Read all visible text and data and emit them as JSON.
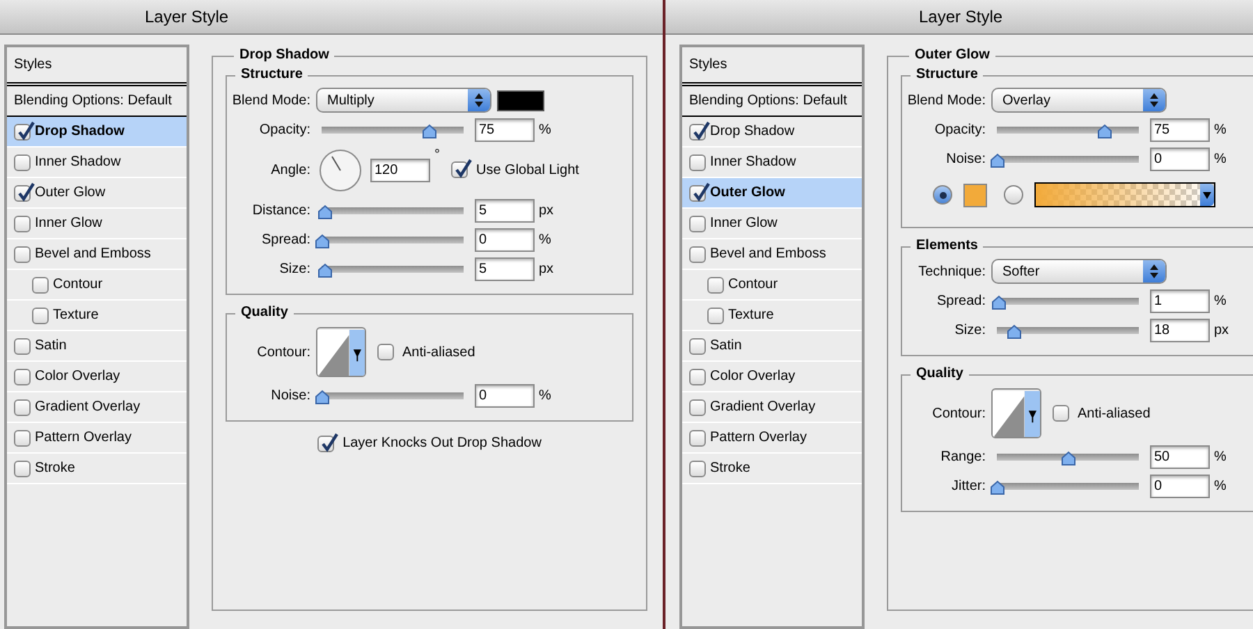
{
  "windows": [
    {
      "title": "Layer Style",
      "styles_header": "Styles",
      "styles": [
        {
          "label": "Blending Options: Default",
          "kind": "plain",
          "selected": false
        },
        {
          "label": "Drop Shadow",
          "kind": "check",
          "checked": true,
          "selected": true
        },
        {
          "label": "Inner Shadow",
          "kind": "check",
          "checked": false,
          "selected": false
        },
        {
          "label": "Outer Glow",
          "kind": "check",
          "checked": true,
          "selected": false
        },
        {
          "label": "Inner Glow",
          "kind": "check",
          "checked": false,
          "selected": false
        },
        {
          "label": "Bevel and Emboss",
          "kind": "check",
          "checked": false,
          "selected": false,
          "children": [
            {
              "label": "Contour",
              "kind": "check",
              "checked": false,
              "selected": false
            },
            {
              "label": "Texture",
              "kind": "check",
              "checked": false,
              "selected": false
            }
          ]
        },
        {
          "label": "Satin",
          "kind": "check",
          "checked": false,
          "selected": false
        },
        {
          "label": "Color Overlay",
          "kind": "check",
          "checked": false,
          "selected": false
        },
        {
          "label": "Gradient Overlay",
          "kind": "check",
          "checked": false,
          "selected": false
        },
        {
          "label": "Pattern Overlay",
          "kind": "check",
          "checked": false,
          "selected": false
        },
        {
          "label": "Stroke",
          "kind": "check",
          "checked": false,
          "selected": false
        }
      ],
      "panel": {
        "title": "Drop Shadow",
        "groups": [
          {
            "title": "Structure",
            "rows": [
              {
                "kind": "select",
                "label": "Blend Mode:",
                "value": "Multiply",
                "color": "#000000"
              },
              {
                "kind": "slider",
                "label": "Opacity:",
                "level": 0.75,
                "value": "75",
                "unit": "%"
              },
              {
                "kind": "angle",
                "label": "Angle:",
                "value": "120",
                "unit": "°",
                "checkbox": {
                  "label": "Use Global Light",
                  "checked": true
                }
              },
              {
                "kind": "slider",
                "label": "Distance:",
                "level": 0.02,
                "value": "5",
                "unit": "px"
              },
              {
                "kind": "slider",
                "label": "Spread:",
                "level": 0,
                "value": "0",
                "unit": "%"
              },
              {
                "kind": "slider",
                "label": "Size:",
                "level": 0.02,
                "value": "5",
                "unit": "px"
              }
            ]
          },
          {
            "title": "Quality",
            "rows": [
              {
                "kind": "contour",
                "label": "Contour:",
                "checkbox": {
                  "label": "Anti-aliased",
                  "checked": false
                }
              },
              {
                "kind": "slider",
                "label": "Noise:",
                "level": 0,
                "value": "0",
                "unit": "%"
              }
            ]
          }
        ],
        "footer_checkbox": {
          "label": "Layer Knocks Out Drop Shadow",
          "checked": true
        }
      }
    },
    {
      "title": "Layer Style",
      "styles_header": "Styles",
      "styles": [
        {
          "label": "Blending Options: Default",
          "kind": "plain",
          "selected": false
        },
        {
          "label": "Drop Shadow",
          "kind": "check",
          "checked": true,
          "selected": false
        },
        {
          "label": "Inner Shadow",
          "kind": "check",
          "checked": false,
          "selected": false
        },
        {
          "label": "Outer Glow",
          "kind": "check",
          "checked": true,
          "selected": true
        },
        {
          "label": "Inner Glow",
          "kind": "check",
          "checked": false,
          "selected": false
        },
        {
          "label": "Bevel and Emboss",
          "kind": "check",
          "checked": false,
          "selected": false,
          "children": [
            {
              "label": "Contour",
              "kind": "check",
              "checked": false,
              "selected": false
            },
            {
              "label": "Texture",
              "kind": "check",
              "checked": false,
              "selected": false
            }
          ]
        },
        {
          "label": "Satin",
          "kind": "check",
          "checked": false,
          "selected": false
        },
        {
          "label": "Color Overlay",
          "kind": "check",
          "checked": false,
          "selected": false
        },
        {
          "label": "Gradient Overlay",
          "kind": "check",
          "checked": false,
          "selected": false
        },
        {
          "label": "Pattern Overlay",
          "kind": "check",
          "checked": false,
          "selected": false
        },
        {
          "label": "Stroke",
          "kind": "check",
          "checked": false,
          "selected": false
        }
      ],
      "panel": {
        "title": "Outer Glow",
        "groups": [
          {
            "title": "Structure",
            "rows": [
              {
                "kind": "select",
                "label": "Blend Mode:",
                "value": "Overlay"
              },
              {
                "kind": "slider",
                "label": "Opacity:",
                "level": 0.75,
                "value": "75",
                "unit": "%"
              },
              {
                "kind": "slider",
                "label": "Noise:",
                "level": 0,
                "value": "0",
                "unit": "%"
              },
              {
                "kind": "fill",
                "options": [
                  {
                    "kind": "solid",
                    "selected": true,
                    "color": "#f2aa3a"
                  },
                  {
                    "kind": "gradient",
                    "selected": false,
                    "color": "#f2aa3a"
                  }
                ]
              }
            ]
          },
          {
            "title": "Elements",
            "rows": [
              {
                "kind": "select",
                "label": "Technique:",
                "value": "Softer"
              },
              {
                "kind": "slider",
                "label": "Spread:",
                "level": 0.01,
                "value": "1",
                "unit": "%"
              },
              {
                "kind": "slider",
                "label": "Size:",
                "level": 0.12,
                "value": "18",
                "unit": "px"
              }
            ]
          },
          {
            "title": "Quality",
            "rows": [
              {
                "kind": "contour",
                "label": "Contour:",
                "checkbox": {
                  "label": "Anti-aliased",
                  "checked": false
                }
              },
              {
                "kind": "slider",
                "label": "Range:",
                "level": 0.5,
                "value": "50",
                "unit": "%"
              },
              {
                "kind": "slider",
                "label": "Jitter:",
                "level": 0,
                "value": "0",
                "unit": "%"
              }
            ]
          }
        ]
      }
    }
  ]
}
